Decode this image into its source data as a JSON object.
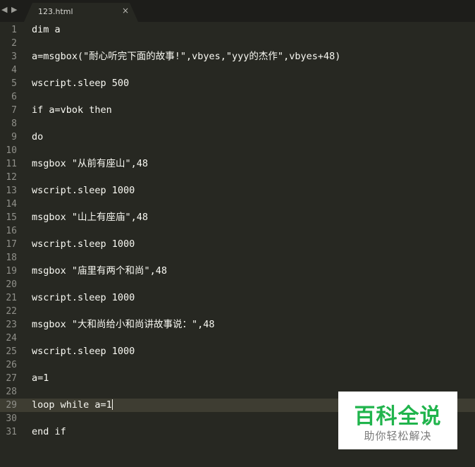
{
  "tabbar": {
    "nav_left": "◀",
    "nav_right": "▶",
    "tab": {
      "title": "123.html",
      "close": "×"
    }
  },
  "editor": {
    "lines": [
      {
        "n": "1",
        "text": "dim a"
      },
      {
        "n": "2",
        "text": ""
      },
      {
        "n": "3",
        "text": "a=msgbox(\"耐心听完下面的故事!\",vbyes,\"yyy的杰作\",vbyes+48)"
      },
      {
        "n": "4",
        "text": ""
      },
      {
        "n": "5",
        "text": "wscript.sleep 500"
      },
      {
        "n": "6",
        "text": ""
      },
      {
        "n": "7",
        "text": "if a=vbok then"
      },
      {
        "n": "8",
        "text": ""
      },
      {
        "n": "9",
        "text": "do"
      },
      {
        "n": "10",
        "text": ""
      },
      {
        "n": "11",
        "text": "msgbox \"从前有座山\",48"
      },
      {
        "n": "12",
        "text": ""
      },
      {
        "n": "13",
        "text": "wscript.sleep 1000"
      },
      {
        "n": "14",
        "text": ""
      },
      {
        "n": "15",
        "text": "msgbox \"山上有座庙\",48"
      },
      {
        "n": "16",
        "text": ""
      },
      {
        "n": "17",
        "text": "wscript.sleep 1000"
      },
      {
        "n": "18",
        "text": ""
      },
      {
        "n": "19",
        "text": "msgbox \"庙里有两个和尚\",48"
      },
      {
        "n": "20",
        "text": ""
      },
      {
        "n": "21",
        "text": "wscript.sleep 1000"
      },
      {
        "n": "22",
        "text": ""
      },
      {
        "n": "23",
        "text": "msgbox \"大和尚给小和尚讲故事说：\",48"
      },
      {
        "n": "24",
        "text": ""
      },
      {
        "n": "25",
        "text": "wscript.sleep 1000"
      },
      {
        "n": "26",
        "text": ""
      },
      {
        "n": "27",
        "text": "a=1"
      },
      {
        "n": "28",
        "text": ""
      },
      {
        "n": "29",
        "text": "loop while a=1"
      },
      {
        "n": "30",
        "text": ""
      },
      {
        "n": "31",
        "text": "end if"
      }
    ],
    "current_line": 29
  },
  "watermark": {
    "title": "百科全说",
    "subtitle": "助你轻松解决"
  },
  "colors": {
    "background": "#272822",
    "tabbar": "#1d1d1a",
    "text": "#f8f8f2",
    "line_number": "#90908a",
    "current_line": "#3e3d32",
    "watermark_green": "#20b44c"
  }
}
